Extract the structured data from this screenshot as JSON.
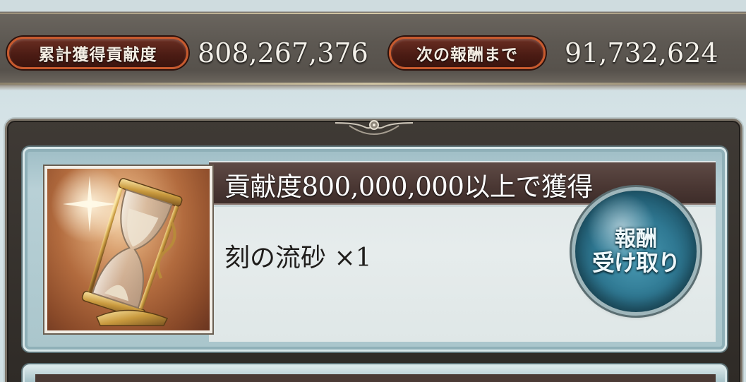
{
  "stats": {
    "total_label": "累計獲得貢献度",
    "total_value": "808,267,376",
    "next_label": "次の報酬まで",
    "next_value": "91,732,624"
  },
  "reward": {
    "condition": "貢献度800,000,000以上で獲得",
    "item_name": "刻の流砂 ×1",
    "item_icon": "hourglass-icon",
    "claim_line1": "報酬",
    "claim_line2": "受け取り"
  },
  "colors": {
    "label_border": "#c85a2e",
    "label_fill": "#4c1c14",
    "claim_button": "#2f7892",
    "title_band": "#4a3733"
  }
}
